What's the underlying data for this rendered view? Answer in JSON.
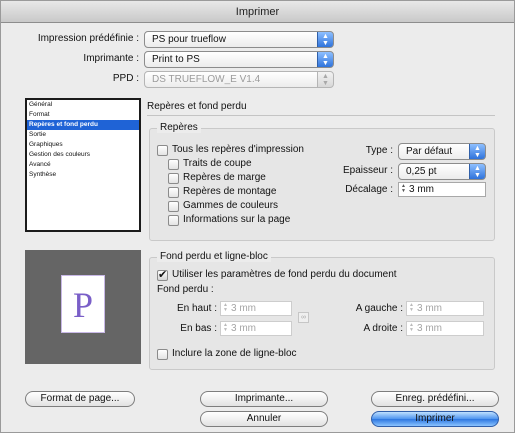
{
  "window": {
    "title": "Imprimer"
  },
  "top": {
    "preset_label": "Impression prédéfinie :",
    "preset_value": "PS pour trueflow",
    "printer_label": "Imprimante :",
    "printer_value": "Print to PS",
    "ppd_label": "PPD :",
    "ppd_value": "DS TRUEFLOW_E V1.4"
  },
  "sidebar": {
    "items": [
      "Général",
      "Format",
      "Repères et fond perdu",
      "Sortie",
      "Graphiques",
      "Gestion des couleurs",
      "Avancé",
      "Synthèse"
    ],
    "selected_index": 2
  },
  "preview": {
    "letter": "P"
  },
  "section": {
    "title": "Repères et fond perdu"
  },
  "marks": {
    "group_title": "Repères",
    "all_marks": "Tous les repères d'impression",
    "crop": "Traits de coupe",
    "bleed": "Repères de marge",
    "registration": "Repères de montage",
    "color_bars": "Gammes de couleurs",
    "page_info": "Informations sur la page",
    "type_label": "Type :",
    "type_value": "Par défaut",
    "weight_label": "Epaisseur :",
    "weight_value": "0,25 pt",
    "offset_label": "Décalage :",
    "offset_value": "3 mm"
  },
  "bleed": {
    "group_title": "Fond perdu et ligne-bloc",
    "use_doc": "Utiliser les paramètres de fond perdu du document",
    "use_doc_checked": true,
    "bleed_label": "Fond perdu :",
    "top_label": "En haut :",
    "top_value": "3 mm",
    "bottom_label": "En bas :",
    "bottom_value": "3 mm",
    "left_label": "A gauche :",
    "left_value": "3 mm",
    "right_label": "A droite :",
    "right_value": "3 mm",
    "slug": "Inclure la zone de ligne-bloc"
  },
  "buttons": {
    "page_setup": "Format de page...",
    "printer": "Imprimante...",
    "save_preset": "Enreg. prédéfini...",
    "cancel": "Annuler",
    "print": "Imprimer"
  },
  "icons": {
    "popup": "up-down-arrows-icon",
    "stepper": "stepper-arrows-icon",
    "chain": "chain-link-icon",
    "check": "checkmark-icon"
  }
}
